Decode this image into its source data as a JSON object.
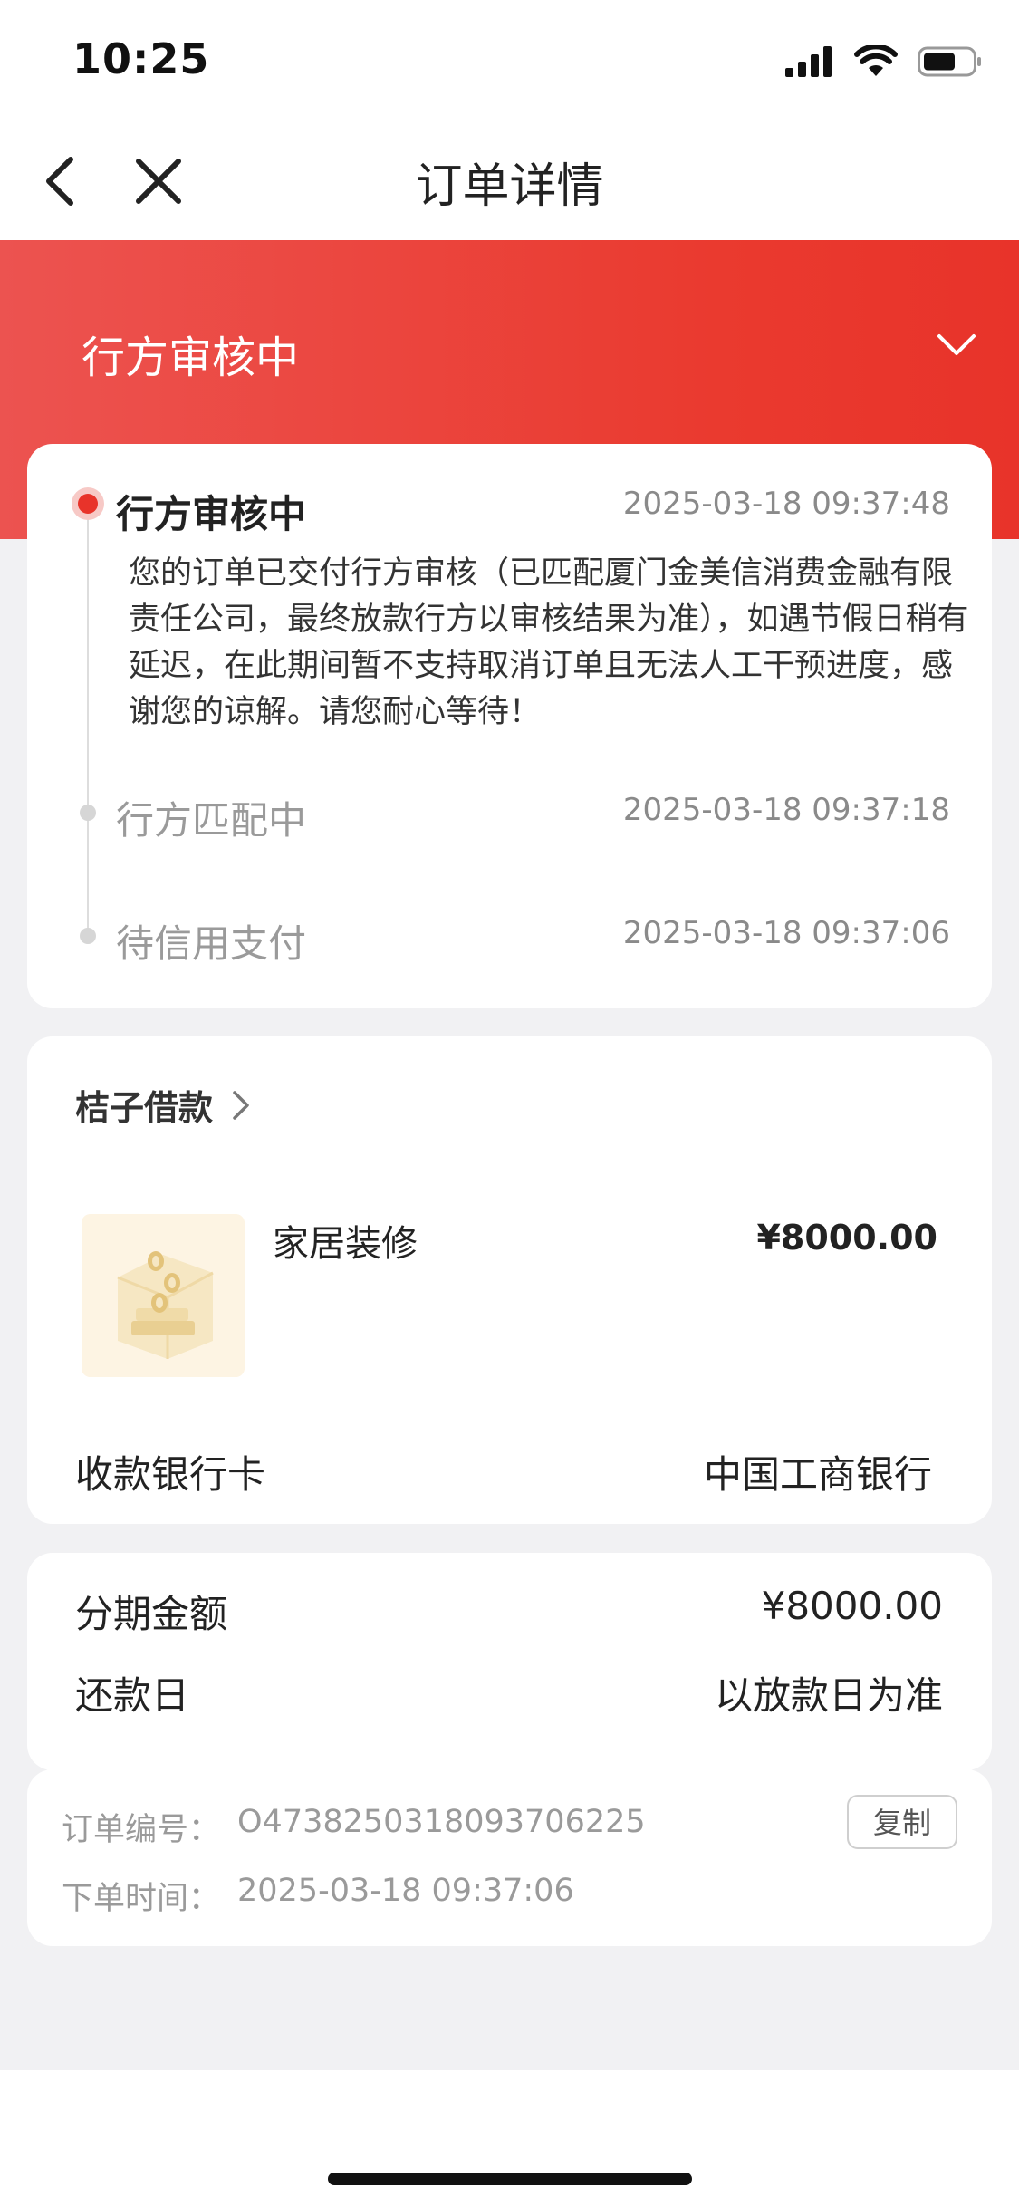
{
  "status_bar": {
    "time": "10:25"
  },
  "nav": {
    "title": "订单详情"
  },
  "header": {
    "status": "行方审核中"
  },
  "timeline": [
    {
      "title": "行方审核中",
      "time": "2025-03-18 09:37:48",
      "description": "您的订单已交付行方审核（已匹配厦门金美信消费金融有限责任公司，最终放款行方以审核结果为准），如遇节假日稍有延迟，在此期间暂不支持取消订单且无法人工干预进度，感谢您的谅解。请您耐心等待！"
    },
    {
      "title": "行方匹配中",
      "time": "2025-03-18 09:37:18"
    },
    {
      "title": "待信用支付",
      "time": "2025-03-18 09:37:06"
    }
  ],
  "product": {
    "merchant": "桔子借款",
    "name": "家居装修",
    "price": "¥8000.00",
    "bank_label": "收款银行卡",
    "bank_value": "中国工商银行"
  },
  "installment": {
    "amount_label": "分期金额",
    "amount_value": "¥8000.00",
    "repay_label": "还款日",
    "repay_value": "以放款日为准"
  },
  "order_info": {
    "number_label": "订单编号：",
    "number_value": "O473825031809370622​5",
    "time_label": "下单时间：",
    "time_value": "2025-03-18 09:37:06",
    "copy_label": "复制"
  },
  "colors": {
    "accent": "#e8332a",
    "background": "#f1f1f3"
  }
}
